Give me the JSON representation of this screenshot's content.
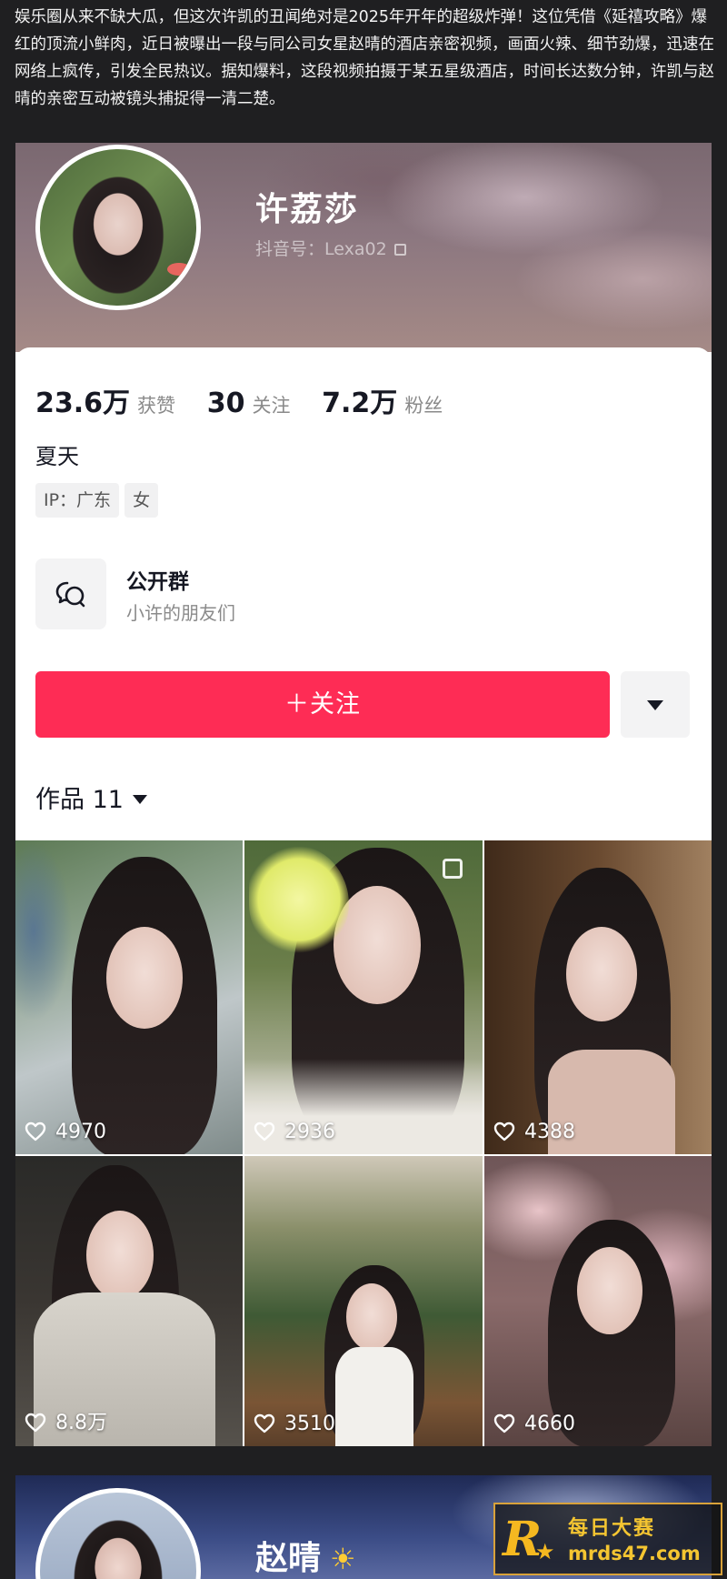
{
  "article": {
    "text": "娱乐圈从来不缺大瓜，但这次许凯的丑闻绝对是2025年开年的超级炸弹！这位凭借《延禧攻略》爆红的顶流小鲜肉，近日被曝出一段与同公司女星赵晴的酒店亲密视频，画面火辣、细节劲爆，迅速在网络上疯传，引发全民热议。据知爆料，这段视频拍摄于某五星级酒店，时间长达数分钟，许凯与赵晴的亲密互动被镜头捕捉得一清二楚。"
  },
  "profile": {
    "name": "许荔莎",
    "douyin_id": "抖音号：Lexa02",
    "stats": [
      {
        "num": "23.6万",
        "label": "获赞"
      },
      {
        "num": "30",
        "label": "关注"
      },
      {
        "num": "7.2万",
        "label": "粉丝"
      }
    ],
    "bio": "夏天",
    "tags": [
      "IP：广东",
      "女"
    ],
    "group": {
      "title": "公开群",
      "subtitle": "小许的朋友们",
      "icon": "chat-bubbles-icon"
    },
    "follow_label": "＋关注",
    "more_icon": "caret-down-icon",
    "works_label": "作品 11"
  },
  "works": [
    {
      "likes": "4970"
    },
    {
      "likes": "2936"
    },
    {
      "likes": "4388"
    },
    {
      "likes": "8.8万"
    },
    {
      "likes": "3510"
    },
    {
      "likes": "4660"
    }
  ],
  "profile2": {
    "name": "赵晴",
    "emoji": "☀"
  },
  "watermark": {
    "logo": "R",
    "title": "每日大赛",
    "url": "mrds47.com"
  },
  "colors": {
    "accent": "#fe2c55",
    "page_bg": "#1f1f21",
    "watermark": "#f4c531"
  }
}
